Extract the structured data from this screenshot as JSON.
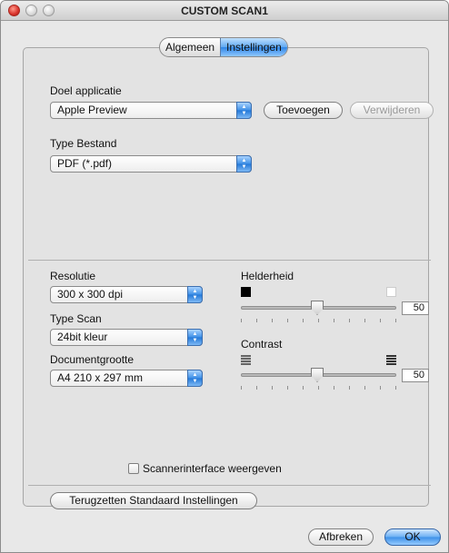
{
  "window": {
    "title": "CUSTOM SCAN1"
  },
  "tabs": [
    {
      "label": "Algemeen",
      "selected": false
    },
    {
      "label": "Instellingen",
      "selected": true
    }
  ],
  "target_app": {
    "label": "Doel applicatie",
    "value": "Apple Preview",
    "add_label": "Toevoegen",
    "remove_label": "Verwijderen"
  },
  "file_type": {
    "label": "Type Bestand",
    "value": "PDF (*.pdf)"
  },
  "resolution": {
    "label": "Resolutie",
    "value": "300 x 300 dpi"
  },
  "scan_type": {
    "label": "Type Scan",
    "value": "24bit kleur"
  },
  "doc_size": {
    "label": "Documentgrootte",
    "value": "A4  210 x 297 mm"
  },
  "brightness": {
    "label": "Helderheid",
    "value": "50"
  },
  "contrast": {
    "label": "Contrast",
    "value": "50"
  },
  "scanner_interface": {
    "label": "Scannerinterface weergeven",
    "checked": false
  },
  "reset_label": "Terugzetten Standaard Instellingen",
  "footer": {
    "cancel_label": "Afbreken",
    "ok_label": "OK"
  },
  "colors": {
    "accent": "#3c8fe8"
  }
}
